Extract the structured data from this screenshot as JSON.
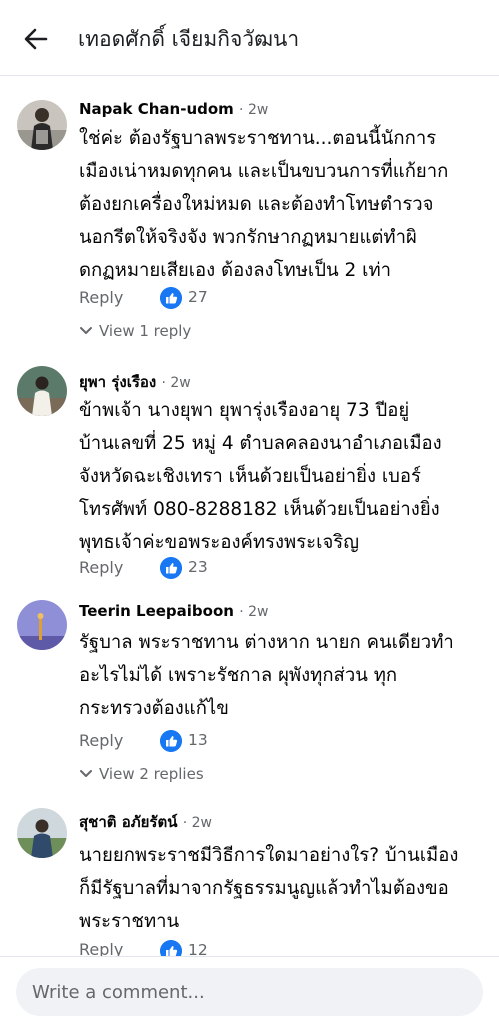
{
  "header": {
    "title": "เทอดศักดิ์ เจียมกิจวัฒนา"
  },
  "comments": [
    {
      "name": "Napak Chan-udom",
      "time": "· 2w",
      "lines": [
        "ใช่ค่ะ ต้องรัฐบาลพระราชทาน...ตอนนี้นักการ",
        "เมืองเน่าหมดทุกคน และเป็นขบวนการที่แก้ยาก",
        "ต้องยกเครื่องใหม่หมด และต้องทำโทษตำรวจ",
        "นอกรีตให้จริงจัง พวกรักษากฏหมายแต่ทำผิ",
        "ดกฏหมายเสียเอง ต้องลงโทษเป็น 2 เท่า"
      ],
      "reply_label": "Reply",
      "likes": "27",
      "view_replies": "View 1 reply"
    },
    {
      "name": "ยุพา รุ่งเรือง",
      "time": "· 2w",
      "lines": [
        "ข้าพเจ้า นางยุพา￼ ยุพารุ่งเรืองอายุ 73 ปีอยู่",
        "บ้านเลขที่ 25 หมู่ 4 ตำบลคลองนาอำเภอเมือง",
        "จังหวัดฉะเชิงเทรา เห็นด้วยเป็นอย่ายิ่ง￼ เบอร์",
        "โทรศัพท์ 080-8288182 เห็นด้วยเป็นอย่างยิ่ง",
        "พุทธเจ้าค่ะขอพระองค์ทรงพระเจริญ ￼￼"
      ],
      "reply_label": "Reply",
      "likes": "23"
    },
    {
      "name": "Teerin Leepaiboon",
      "time": "· 2w",
      "lines": [
        "รัฐบาล พระราชทาน ต่างหาก นายก คนเดียวทำ",
        "อะไรไม่ได้  เพราะรัชกาล ผุพังทุกส่วน ทุก",
        "กระทรวงต้องแก้ไข"
      ],
      "reply_label": "Reply",
      "likes": "13",
      "view_replies": "View 2 replies"
    },
    {
      "name": "สุชาติ อภัยรัตน์",
      "time": "· 2w",
      "lines": [
        "นายยกพระราชมีวิธีการใดมาอย่างใร? บ้านเมือง",
        "ก็มีรัฐบาลที่มาจากรัฐธรรมนูญแล้วทำไมต้องขอ",
        "พระราชทาน"
      ],
      "reply_label": "Reply",
      "likes": "12"
    }
  ],
  "composer": {
    "placeholder": "Write a comment..."
  }
}
